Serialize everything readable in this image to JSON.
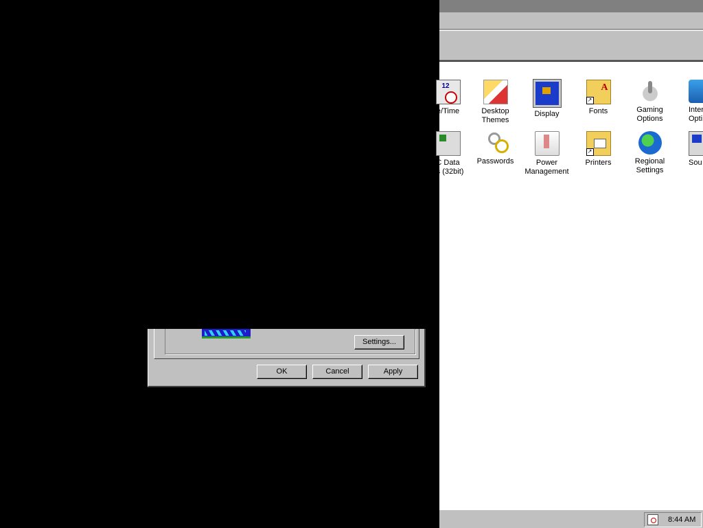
{
  "control_panel": {
    "items": [
      {
        "label": "e/Time",
        "icon": "date-time-icon"
      },
      {
        "label": "Desktop\nThemes",
        "icon": "desktop-themes-icon"
      },
      {
        "label": "Display",
        "icon": "display-icon"
      },
      {
        "label": "Fonts",
        "icon": "fonts-folder-icon"
      },
      {
        "label": "Gaming\nOptions",
        "icon": "gaming-options-icon"
      },
      {
        "label": "Inter\nOpti",
        "icon": "internet-options-icon"
      },
      {
        "label": "C Data\nes (32bit)",
        "icon": "odbc-data-sources-icon"
      },
      {
        "label": "Passwords",
        "icon": "passwords-keys-icon"
      },
      {
        "label": "Power\nManagement",
        "icon": "power-management-icon"
      },
      {
        "label": "Printers",
        "icon": "printers-folder-icon"
      },
      {
        "label": "Regional\nSettings",
        "icon": "regional-settings-globe-icon"
      },
      {
        "label": "Sou",
        "icon": "sounds-icon"
      }
    ]
  },
  "dialog": {
    "settings_button": "Settings...",
    "ok_button": "OK",
    "cancel_button": "Cancel",
    "apply_button": "Apply"
  },
  "taskbar": {
    "clock": "8:44 AM",
    "tray_icon": "scheduler-clock-icon"
  },
  "colors": {
    "desktop_black": "#000000",
    "window_gray": "#c0c0c0",
    "content_white": "#ffffff"
  }
}
